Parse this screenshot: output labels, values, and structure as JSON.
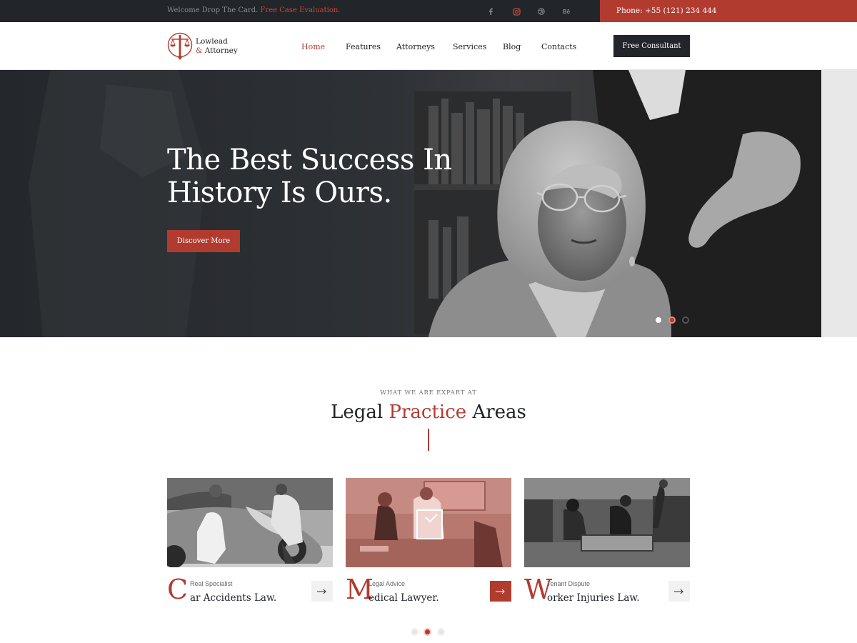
{
  "topbar": {
    "welcome": "Welcome Drop The Card.",
    "welcome_link": "Free Case Evaluation.",
    "socials": [
      "facebook-icon",
      "instagram-icon",
      "dribbble-icon",
      "behance-icon"
    ],
    "behance_glyph": "Bē",
    "phone": "Phone: +55 (121) 234 444"
  },
  "brand": {
    "line1": "Lowlead",
    "amp": "&",
    "line2": "Attorney"
  },
  "nav": {
    "items": [
      "Home",
      "Features",
      "Attorneys",
      "Services",
      "Blog",
      "Contacts"
    ],
    "active": "Home",
    "cta": "Free Consultant"
  },
  "hero": {
    "line1": "The Best Success In",
    "line2": "History Is Ours.",
    "button": "Discover More",
    "slides": 3,
    "active_slide": 2
  },
  "section": {
    "kicker": "WHAT WE ARE EXPART AT",
    "title_pre": "Legal",
    "title_accent": "Practice",
    "title_post": "Areas"
  },
  "cards": [
    {
      "initial": "C",
      "rest": "ar  Accidents Law.",
      "sub": "Real Specialist",
      "active": false
    },
    {
      "initial": "M",
      "rest": "edical Lawyer.",
      "sub": "Legal Advice",
      "active": true
    },
    {
      "initial": "W",
      "rest": "orker Injuries Law.",
      "sub": "Tenant Dispute",
      "active": false
    }
  ],
  "pager": {
    "count": 3,
    "active": 2
  },
  "colors": {
    "accent": "#b23b30",
    "dark": "#222529"
  }
}
